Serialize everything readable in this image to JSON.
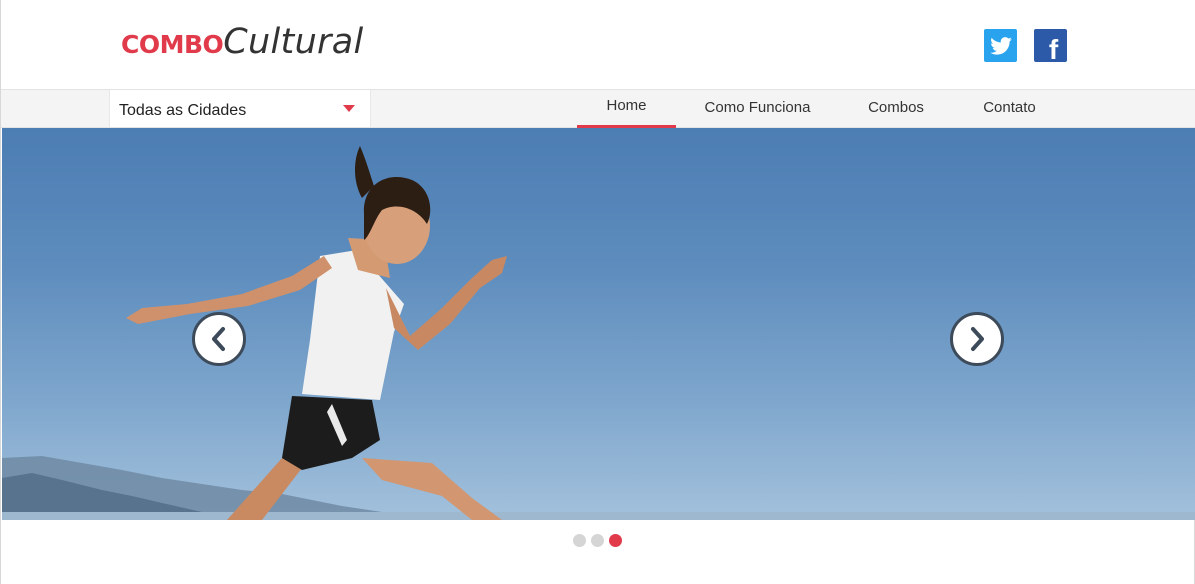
{
  "header": {
    "logo_bold": "COMBO",
    "logo_light": "Cultural",
    "social": [
      {
        "name": "twitter",
        "icon": "twitter-icon",
        "color": "#2aa3ef"
      },
      {
        "name": "facebook",
        "icon": "facebook-icon",
        "color": "#2d5aa8",
        "glyph": "f"
      }
    ]
  },
  "city_select": {
    "value": "Todas as Cidades"
  },
  "nav": {
    "items": [
      {
        "label": "Home",
        "active": true
      },
      {
        "label": "Como Funciona",
        "active": false
      },
      {
        "label": "Combos",
        "active": false
      },
      {
        "label": "Contato",
        "active": false
      }
    ]
  },
  "slider": {
    "slide_count": 3,
    "active_slide": 3,
    "prev_icon": "chevron-left-icon",
    "next_icon": "chevron-right-icon"
  },
  "colors": {
    "accent": "#e03a4b",
    "text": "#333333",
    "navbar_bg": "#f4f4f4"
  }
}
